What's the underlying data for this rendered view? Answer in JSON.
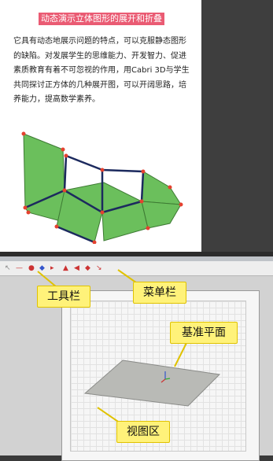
{
  "slide": {
    "title": "动态演示立体图形的展开和折叠",
    "paragraph": "它具有动态地展示问题的特点，可以克服静态图形的缺陷。对发展学生的思维能力、开发智力、促进素质教育有着不可忽视的作用，用Cabri 3D与学生共同探讨正方体的几种展开图，可以开阔思路，培养能力，提高数学素养。"
  },
  "callouts": {
    "toolbar": "工具栏",
    "menu_bar": "菜单栏",
    "base_plane": "基准平面",
    "view_area": "视图区"
  },
  "colors": {
    "title_bg": "#ea5b73",
    "face_green": "#6bbf5c",
    "edge_dark": "#1c2a5e",
    "vertex_red": "#e5412f",
    "callout_yellow": "#fff27a"
  },
  "toolbar_icons": [
    "pointer-icon",
    "line-icon",
    "point-icon",
    "plane-icon",
    "polygon-icon",
    "solid-icon",
    "transform-icon",
    "measure-icon"
  ]
}
